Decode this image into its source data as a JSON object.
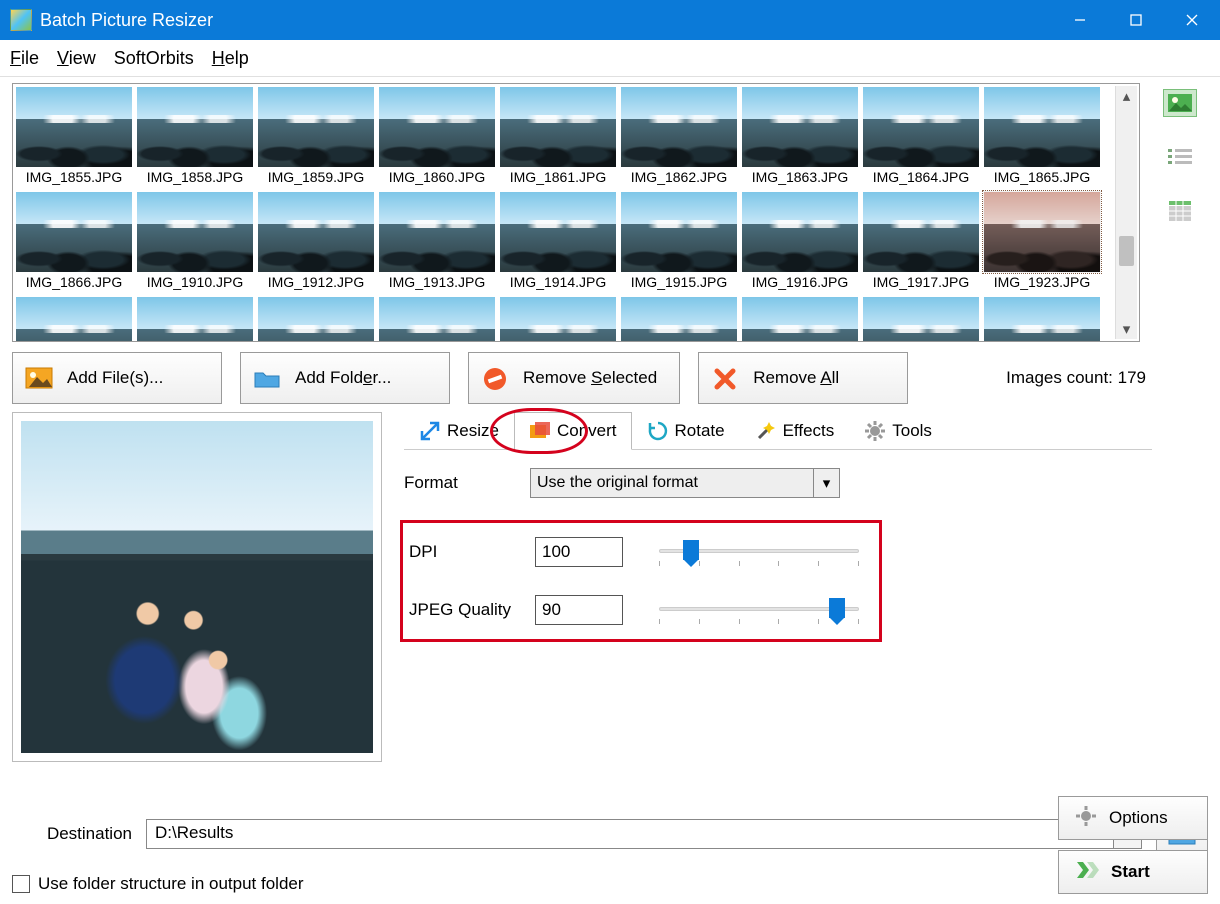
{
  "window": {
    "title": "Batch Picture Resizer"
  },
  "menu": {
    "file": "File",
    "view": "View",
    "softorbits": "SoftOrbits",
    "help": "Help"
  },
  "thumbs": {
    "row1": [
      "IMG_1855.JPG",
      "IMG_1858.JPG",
      "IMG_1859.JPG",
      "IMG_1860.JPG",
      "IMG_1861.JPG",
      "IMG_1862.JPG",
      "IMG_1863.JPG",
      "IMG_1864.JPG",
      "IMG_1865.JPG"
    ],
    "row2": [
      "IMG_1866.JPG",
      "IMG_1910.JPG",
      "IMG_1912.JPG",
      "IMG_1913.JPG",
      "IMG_1914.JPG",
      "IMG_1915.JPG",
      "IMG_1916.JPG",
      "IMG_1917.JPG",
      "IMG_1923.JPG"
    ],
    "selected": "IMG_1923.JPG"
  },
  "toolbar": {
    "add_files": "Add File(s)...",
    "add_folder": "Add Folder...",
    "remove_selected": "Remove Selected",
    "remove_all": "Remove All",
    "count_label": "Images count: 179"
  },
  "tabs": {
    "resize": "Resize",
    "convert": "Convert",
    "rotate": "Rotate",
    "effects": "Effects",
    "tools": "Tools",
    "active": "convert"
  },
  "convert": {
    "format_label": "Format",
    "format_value": "Use the original format",
    "dpi_label": "DPI",
    "dpi_value": "100",
    "jpeg_label": "JPEG Quality",
    "jpeg_value": "90"
  },
  "destination": {
    "label": "Destination",
    "value": "D:\\Results",
    "use_folder_structure": "Use folder structure in output folder"
  },
  "buttons": {
    "options": "Options",
    "start": "Start"
  }
}
